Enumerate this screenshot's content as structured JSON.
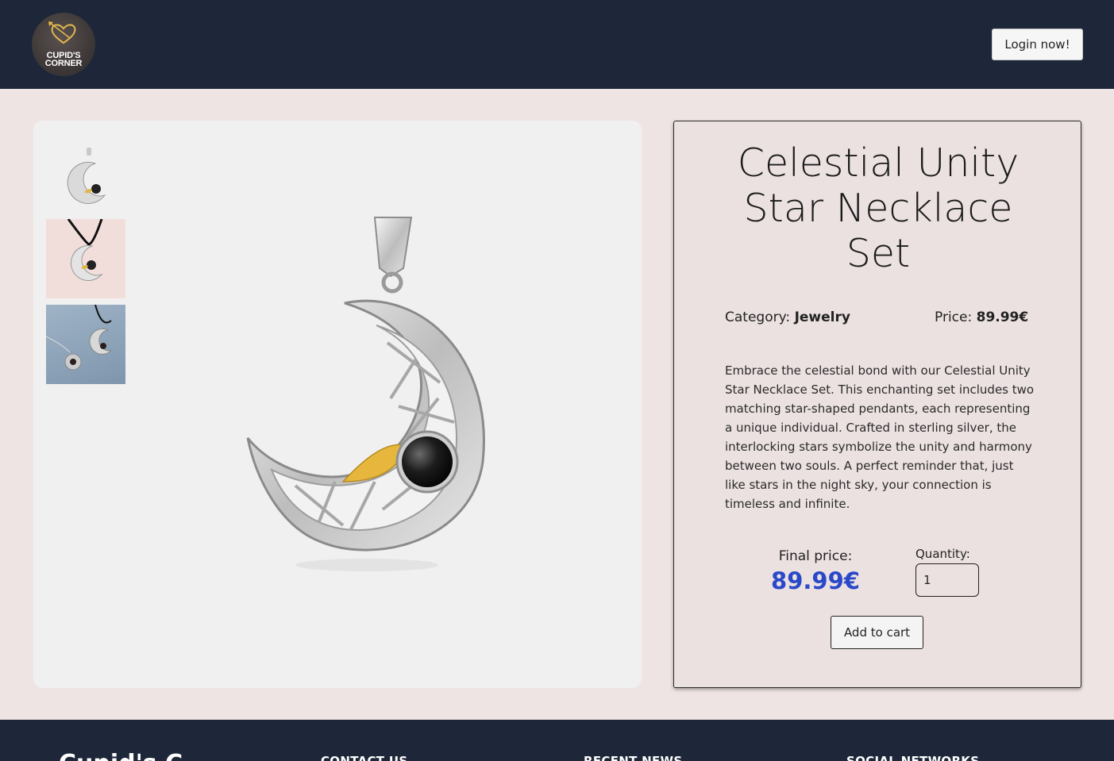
{
  "header": {
    "logo_line1": "CUPID'S",
    "logo_line2": "CORNER",
    "login_label": "Login now!"
  },
  "product": {
    "title": "Celestial Unity Star Necklace Set",
    "category_label": "Category:",
    "category_value": "Jewelry",
    "price_label": "Price:",
    "price_value": "89.99€",
    "description": "Embrace the celestial bond with our Celestial Unity Star Necklace Set. This enchanting set includes two matching star-shaped pendants, each representing a unique individual. Crafted in sterling silver, the interlocking stars symbolize the unity and harmony between two souls. A perfect reminder that, just like stars in the night sky, your connection is timeless and infinite.",
    "final_price_label": "Final price:",
    "final_price_value": "89.99€",
    "quantity_label": "Quantity:",
    "quantity_value": "1",
    "add_to_cart_label": "Add to cart"
  },
  "footer": {
    "brand": "Cupid's C",
    "col1": "CONTACT US",
    "col2": "RECENT NEWS",
    "col3": "SOCIAL NETWORKS"
  },
  "colors": {
    "nav_bg": "#1d2739",
    "page_bg": "#efe4e4",
    "accent_price": "#2a49c9"
  }
}
